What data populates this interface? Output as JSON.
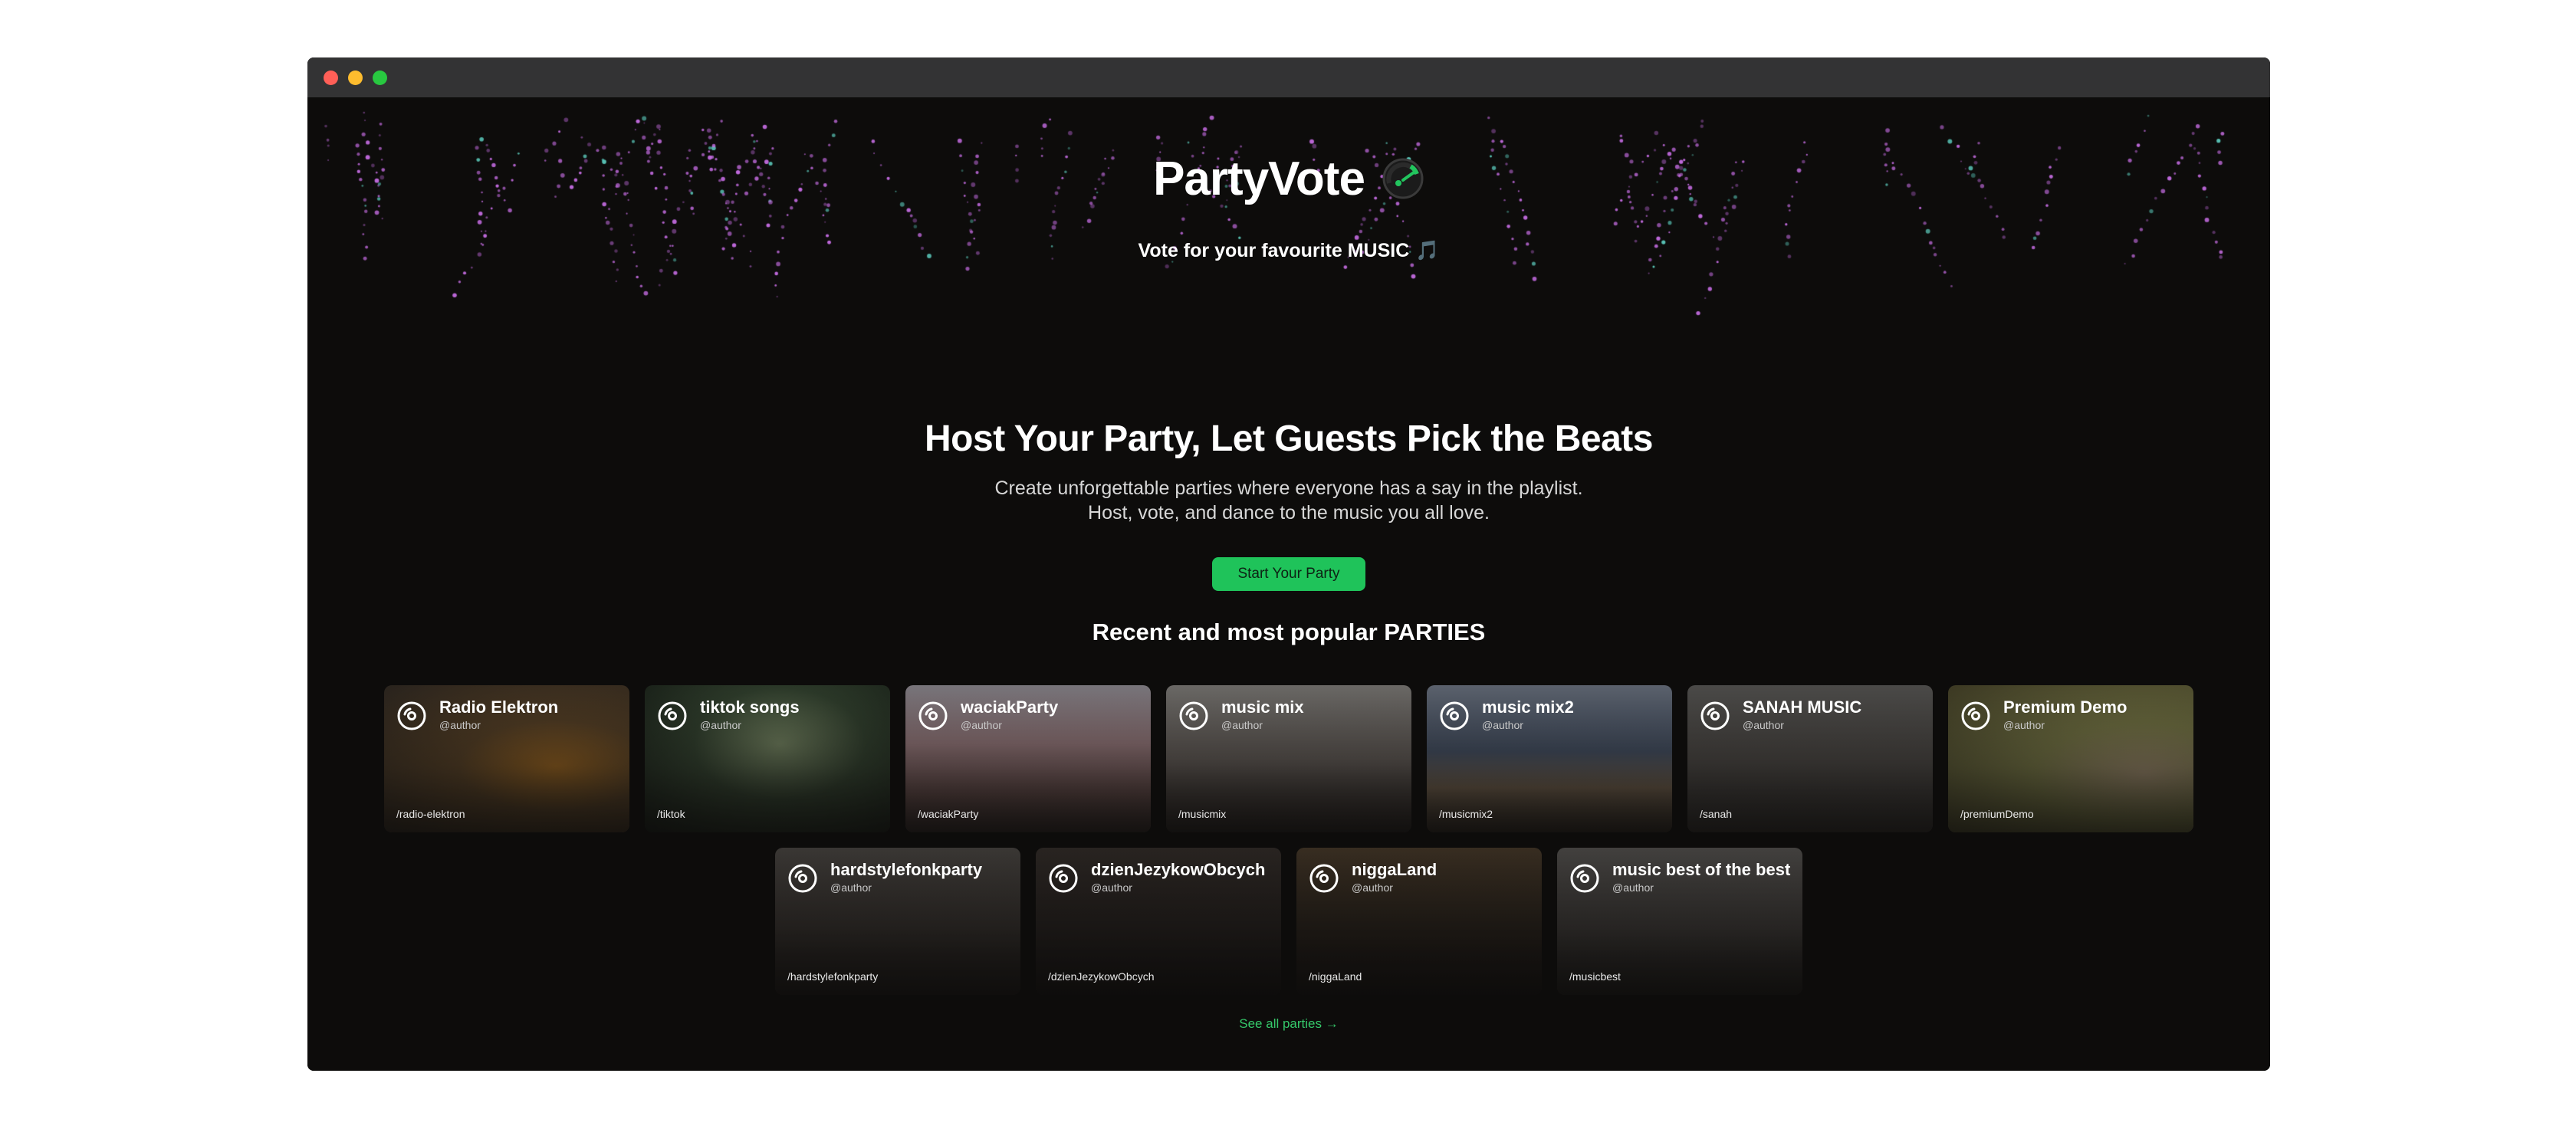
{
  "window": {
    "controls": [
      "close",
      "minimize",
      "maximize"
    ],
    "control_colors": {
      "close": "#ff5f57",
      "minimize": "#febc2e",
      "maximize": "#28c840"
    }
  },
  "header": {
    "title": "PartyVote",
    "logo_icon": "speedometer-icon",
    "tagline": "Vote for your favourite MUSIC",
    "tagline_icon": "🎵"
  },
  "hero": {
    "title": "Host Your Party, Let Guests Pick the Beats",
    "description": "Create unforgettable parties where everyone has a say in the playlist. Host, vote, and dance to the music you all love.",
    "cta_label": "Start Your Party"
  },
  "parties_section": {
    "title": "Recent and most popular PARTIES",
    "see_all_label": "See all parties →",
    "parties": [
      {
        "name": "Radio Elektron",
        "author": "@author",
        "slug": "/radio-elektron",
        "icon": "disc-icon"
      },
      {
        "name": "tiktok songs",
        "author": "@author",
        "slug": "/tiktok",
        "icon": "disc-icon"
      },
      {
        "name": "waciakParty",
        "author": "@author",
        "slug": "/waciakParty",
        "icon": "disc-icon"
      },
      {
        "name": "music mix",
        "author": "@author",
        "slug": "/musicmix",
        "icon": "disc-icon"
      },
      {
        "name": "music mix2",
        "author": "@author",
        "slug": "/musicmix2",
        "icon": "disc-icon"
      },
      {
        "name": "SANAH MUSIC",
        "author": "@author",
        "slug": "/sanah",
        "icon": "disc-icon"
      },
      {
        "name": "Premium Demo",
        "author": "@author",
        "slug": "/premiumDemo",
        "icon": "disc-icon"
      },
      {
        "name": "hardstylefonkparty",
        "author": "@author",
        "slug": "/hardstylefonkparty",
        "icon": "disc-icon"
      },
      {
        "name": "dzienJezykowObcych",
        "author": "@author",
        "slug": "/dzienJezykowObcych",
        "icon": "disc-icon"
      },
      {
        "name": "niggaLand",
        "author": "@author",
        "slug": "/niggaLand",
        "icon": "disc-icon"
      },
      {
        "name": "music best of the best",
        "author": "@author",
        "slug": "/musicbest",
        "icon": "disc-icon"
      }
    ]
  },
  "colors": {
    "background": "#0d0c0b",
    "accent": "#1fc35a",
    "link": "#35c86a",
    "particle_purple": "#c86ee6",
    "particle_teal": "#5fd3c4"
  }
}
